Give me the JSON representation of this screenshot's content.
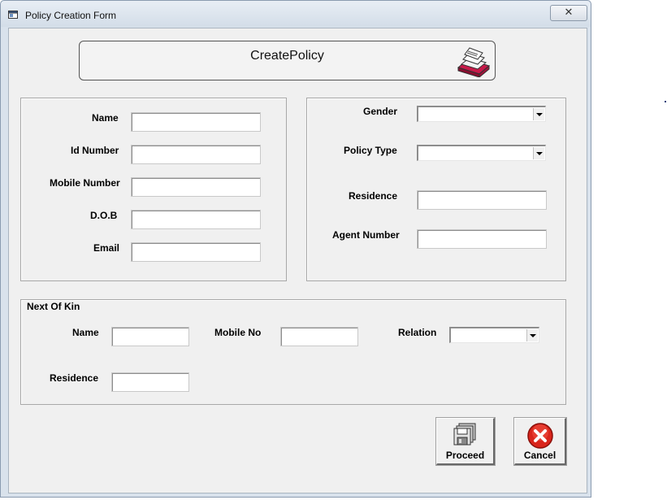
{
  "window": {
    "title": "Policy Creation Form",
    "close_glyph": "✕"
  },
  "banner": {
    "title": "CreatePolicy",
    "icon": "card-file-icon"
  },
  "personal": {
    "name_label": "Name",
    "id_label": "Id Number",
    "mobile_label": "Mobile Number",
    "dob_label": "D.O.B",
    "email_label": "Email",
    "name_value": "",
    "id_value": "",
    "mobile_value": "",
    "dob_value": "",
    "email_value": ""
  },
  "policy": {
    "gender_label": "Gender",
    "gender_value": "",
    "policy_type_label": "Policy Type",
    "policy_type_value": "",
    "residence_label": "Residence",
    "residence_value": "",
    "agent_label": "Agent Number",
    "agent_value": ""
  },
  "kin": {
    "caption": "Next Of Kin",
    "name_label": "Name",
    "name_value": "",
    "mobile_label": "Mobile No",
    "mobile_value": "",
    "relation_label": "Relation",
    "relation_value": "",
    "residence_label": "Residence",
    "residence_value": ""
  },
  "buttons": {
    "proceed_label": "Proceed",
    "proceed_icon": "floppy-disks-icon",
    "cancel_label": "Cancel",
    "cancel_icon": "red-x-icon"
  },
  "colors": {
    "cancel_red": "#d9251c",
    "banner_icon_red": "#b8123f"
  }
}
